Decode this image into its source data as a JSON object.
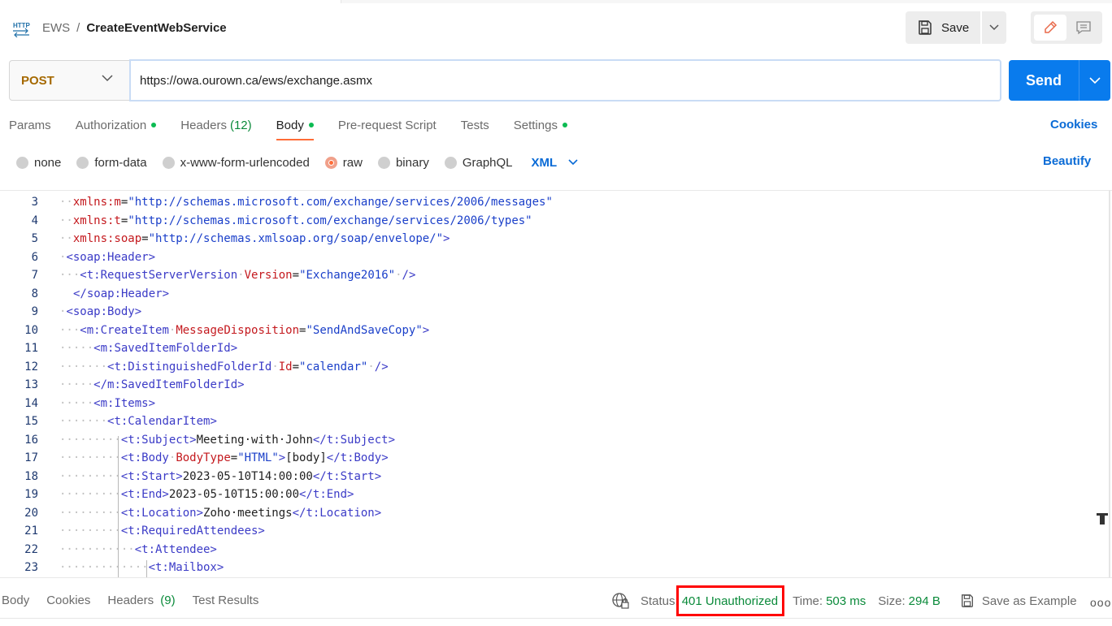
{
  "breadcrumb": {
    "parent": "EWS",
    "separator": "/",
    "current": "CreateEventWebService"
  },
  "toolbar": {
    "save_label": "Save"
  },
  "request": {
    "method": "POST",
    "url": "https://owa.ourown.ca/ews/exchange.asmx",
    "send_label": "Send"
  },
  "req_tabs": {
    "params": "Params",
    "authorization": "Authorization",
    "headers": "Headers",
    "headers_count": "(12)",
    "body": "Body",
    "prerequest": "Pre-request Script",
    "tests": "Tests",
    "settings": "Settings",
    "cookies": "Cookies"
  },
  "body_types": {
    "none": "none",
    "form_data": "form-data",
    "urlencoded": "x-www-form-urlencoded",
    "raw": "raw",
    "binary": "binary",
    "graphql": "GraphQL",
    "selected": "raw",
    "language": "XML",
    "beautify": "Beautify"
  },
  "code_lines": [
    {
      "n": "3"
    },
    {
      "n": "4"
    },
    {
      "n": "5"
    },
    {
      "n": "6"
    },
    {
      "n": "7"
    },
    {
      "n": "8"
    },
    {
      "n": "9"
    },
    {
      "n": "10"
    },
    {
      "n": "11"
    },
    {
      "n": "12"
    },
    {
      "n": "13"
    },
    {
      "n": "14"
    },
    {
      "n": "15"
    },
    {
      "n": "16"
    },
    {
      "n": "17"
    },
    {
      "n": "18"
    },
    {
      "n": "19"
    },
    {
      "n": "20"
    },
    {
      "n": "21"
    },
    {
      "n": "22"
    },
    {
      "n": "23"
    }
  ],
  "code": {
    "l3": {
      "ind": "··",
      "attr": "xmlns:m",
      "eq": "=",
      "val": "\"http://schemas.microsoft.com/exchange/services/2006/messages\""
    },
    "l4": {
      "ind": "··",
      "attr": "xmlns:t",
      "eq": "=",
      "val": "\"http://schemas.microsoft.com/exchange/services/2006/types\""
    },
    "l5": {
      "ind": "··",
      "attr": "xmlns:soap",
      "eq": "=",
      "val": "\"http://schemas.xmlsoap.org/soap/envelope/\"",
      "end": ">"
    },
    "l6": {
      "ind": "·",
      "tag": "<soap:Header>"
    },
    "l7": {
      "ind": "···",
      "tag": "<t:RequestServerVersion",
      "sp": "·",
      "attr": "Version",
      "eq": "=",
      "val": "\"Exchange2016\"",
      "sp2": "·",
      "end": "/>"
    },
    "l8": {
      "ind": "",
      "tag": "</soap:Header>"
    },
    "l9": {
      "ind": "·",
      "tag": "<soap:Body>"
    },
    "l10": {
      "ind": "···",
      "tag": "<m:CreateItem",
      "sp": "·",
      "attr": "MessageDisposition",
      "eq": "=",
      "val": "\"SendAndSaveCopy\"",
      "end": ">"
    },
    "l11": {
      "ind": "·····",
      "tag": "<m:SavedItemFolderId>"
    },
    "l12": {
      "ind": "·······",
      "tag": "<t:DistinguishedFolderId",
      "sp": "·",
      "attr": "Id",
      "eq": "=",
      "val": "\"calendar\"",
      "sp2": "·",
      "end": "/>"
    },
    "l13": {
      "ind": "·····",
      "tag": "</m:SavedItemFolderId>"
    },
    "l14": {
      "ind": "·····",
      "tag": "<m:Items>"
    },
    "l15": {
      "ind": "·······",
      "tag": "<t:CalendarItem>"
    },
    "l16": {
      "ind": "·········",
      "tag": "<t:Subject>",
      "text": "Meeting·with·John",
      "close": "</t:Subject>"
    },
    "l17": {
      "ind": "·········",
      "tag": "<t:Body",
      "sp": "·",
      "attr": "BodyType",
      "eq": "=",
      "val": "\"HTML\"",
      "tag2": ">",
      "text": "[body]",
      "close": "</t:Body>"
    },
    "l18": {
      "ind": "·········",
      "tag": "<t:Start>",
      "text": "2023-05-10T14:00:00",
      "close": "</t:Start>"
    },
    "l19": {
      "ind": "·········",
      "tag": "<t:End>",
      "text": "2023-05-10T15:00:00",
      "close": "</t:End>"
    },
    "l20": {
      "ind": "·········",
      "tag": "<t:Location>",
      "text": "Zoho·meetings",
      "close": "</t:Location>"
    },
    "l21": {
      "ind": "·········",
      "tag": "<t:RequiredAttendees>"
    },
    "l22": {
      "ind": "···········",
      "tag": "<t:Attendee>"
    },
    "l23": {
      "ind": "·············",
      "tag": "<t:Mailbox>"
    }
  },
  "response": {
    "tabs": {
      "body": "Body",
      "cookies": "Cookies",
      "headers": "Headers",
      "headers_count": "(9)",
      "test_results": "Test Results"
    },
    "status_label": "Status:",
    "status_value": "401 Unauthorized",
    "time_label": "Time:",
    "time_value": "503 ms",
    "size_label": "Size:",
    "size_value": "294 B",
    "save_example": "Save as Example",
    "more": "ooo"
  },
  "icons": {
    "http": "http-icon",
    "save": "floppy-icon",
    "chevron": "chevron-down-icon",
    "edit": "pencil-icon",
    "comment": "comment-icon",
    "globe": "globe-lock-icon"
  },
  "colors": {
    "accent": "#097bed",
    "active_tab": "#ff6c37",
    "method": "#a56900",
    "success": "#0a8a3a",
    "highlight": "#ff0000"
  }
}
